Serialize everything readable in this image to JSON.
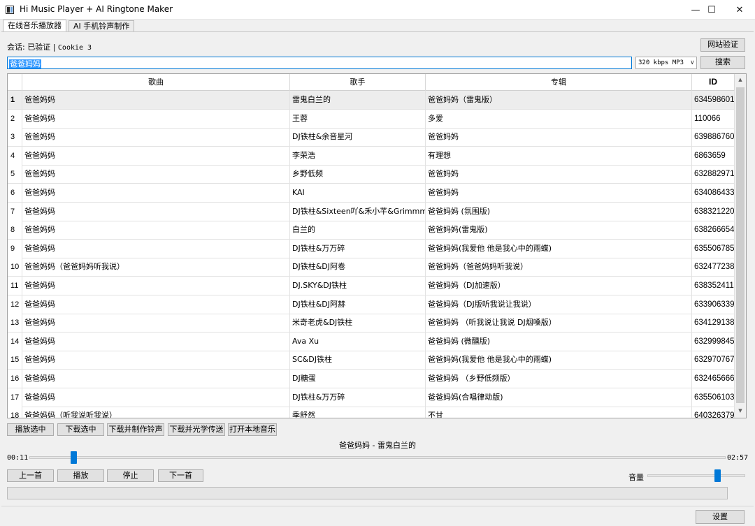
{
  "window": {
    "title": "Hi Music Player + AI Ringtone Maker",
    "minimize_glyph": "—",
    "maximize_glyph": "☐",
    "close_glyph": "✕"
  },
  "tabs": [
    {
      "label": "在线音乐播放器",
      "active": true
    },
    {
      "label": "AI 手机铃声制作",
      "active": false
    }
  ],
  "session": {
    "prefix": "会话: 已验证 | ",
    "cookie": "Cookie 3",
    "verify_button": "网站验证"
  },
  "search": {
    "query": "爸爸妈妈",
    "quality": "320 kbps MP3",
    "button": "搜索"
  },
  "table": {
    "columns": [
      "歌曲",
      "歌手",
      "专辑",
      "ID"
    ],
    "selected_row": 1,
    "rows": [
      {
        "n": "1",
        "song": "爸爸妈妈",
        "artist": "雷鬼白兰的",
        "album": "爸爸妈妈（雷鬼版）",
        "id": "634598601"
      },
      {
        "n": "2",
        "song": "爸爸妈妈",
        "artist": "王蓉",
        "album": "多爱",
        "id": "110066"
      },
      {
        "n": "3",
        "song": "爸爸妈妈",
        "artist": "DJ铁柱&余音星河",
        "album": "爸爸妈妈",
        "id": "639886760"
      },
      {
        "n": "4",
        "song": "爸爸妈妈",
        "artist": "李荣浩",
        "album": "有理想",
        "id": "6863659"
      },
      {
        "n": "5",
        "song": "爸爸妈妈",
        "artist": "乡野低频",
        "album": "爸爸妈妈",
        "id": "632882971"
      },
      {
        "n": "6",
        "song": "爸爸妈妈",
        "artist": "KAI",
        "album": "爸爸妈妈",
        "id": "634086433"
      },
      {
        "n": "7",
        "song": "爸爸妈妈",
        "artist": "DJ铁柱&Sixteen吖&禾小芊&Grimmmz",
        "album": "爸爸妈妈 (氛围版)",
        "id": "638321220"
      },
      {
        "n": "8",
        "song": "爸爸妈妈",
        "artist": "白兰的",
        "album": "爸爸妈妈(雷鬼版)",
        "id": "638266654"
      },
      {
        "n": "9",
        "song": "爸爸妈妈",
        "artist": "DJ铁柱&万万碎",
        "album": "爸爸妈妈(我爱他 他是我心中的雨蝶)",
        "id": "635506785"
      },
      {
        "n": "10",
        "song": "爸爸妈妈（爸爸妈妈听我说）",
        "artist": "DJ铁柱&DJ阿卷",
        "album": "爸爸妈妈（爸爸妈妈听我说）",
        "id": "632477238"
      },
      {
        "n": "11",
        "song": "爸爸妈妈",
        "artist": "DJ.SKY&DJ铁柱",
        "album": "爸爸妈妈（DJ加速版）",
        "id": "638352411"
      },
      {
        "n": "12",
        "song": "爸爸妈妈",
        "artist": "DJ铁柱&DJ阿赫",
        "album": "爸爸妈妈（DJ版听我说让我说）",
        "id": "633906339"
      },
      {
        "n": "13",
        "song": "爸爸妈妈",
        "artist": "米奇老虎&DJ铁柱",
        "album": "爸爸妈妈 （听我说让我说 DJ烟嗓版）",
        "id": "634129138"
      },
      {
        "n": "14",
        "song": "爸爸妈妈",
        "artist": "Ava Xu",
        "album": "爸爸妈妈 (微醺版)",
        "id": "632999845"
      },
      {
        "n": "15",
        "song": "爸爸妈妈",
        "artist": "SC&DJ铁柱",
        "album": "爸爸妈妈(我爱他 他是我心中的雨蝶)",
        "id": "632970767"
      },
      {
        "n": "16",
        "song": "爸爸妈妈",
        "artist": "DJ糖蛋",
        "album": "爸爸妈妈 （乡野低频版）",
        "id": "632465666"
      },
      {
        "n": "17",
        "song": "爸爸妈妈",
        "artist": "DJ铁柱&万万碎",
        "album": "爸爸妈妈(合唱律动版)",
        "id": "635506103"
      },
      {
        "n": "18",
        "song": "爸爸妈妈（听我说听我说）",
        "artist": "季舒然",
        "album": "不甘",
        "id": "640326379"
      }
    ]
  },
  "actions": [
    "播放选中",
    "下载选中",
    "下载并制作铃声",
    "下载并光学传送",
    "打开本地音乐"
  ],
  "player": {
    "now_playing": "爸爸妈妈 - 雷鬼白兰的",
    "elapsed": "00:11",
    "duration": "02:57",
    "position_fraction": 0.064,
    "prev_button": "上一首",
    "play_button": "播放",
    "stop_button": "停止",
    "next_button": "下一首",
    "volume_label": "音量",
    "volume_fraction": 0.72,
    "progress_fraction": 0
  },
  "settings_button": "设置",
  "colors": {
    "accent": "#0078d7",
    "selection": "#3399ff"
  }
}
